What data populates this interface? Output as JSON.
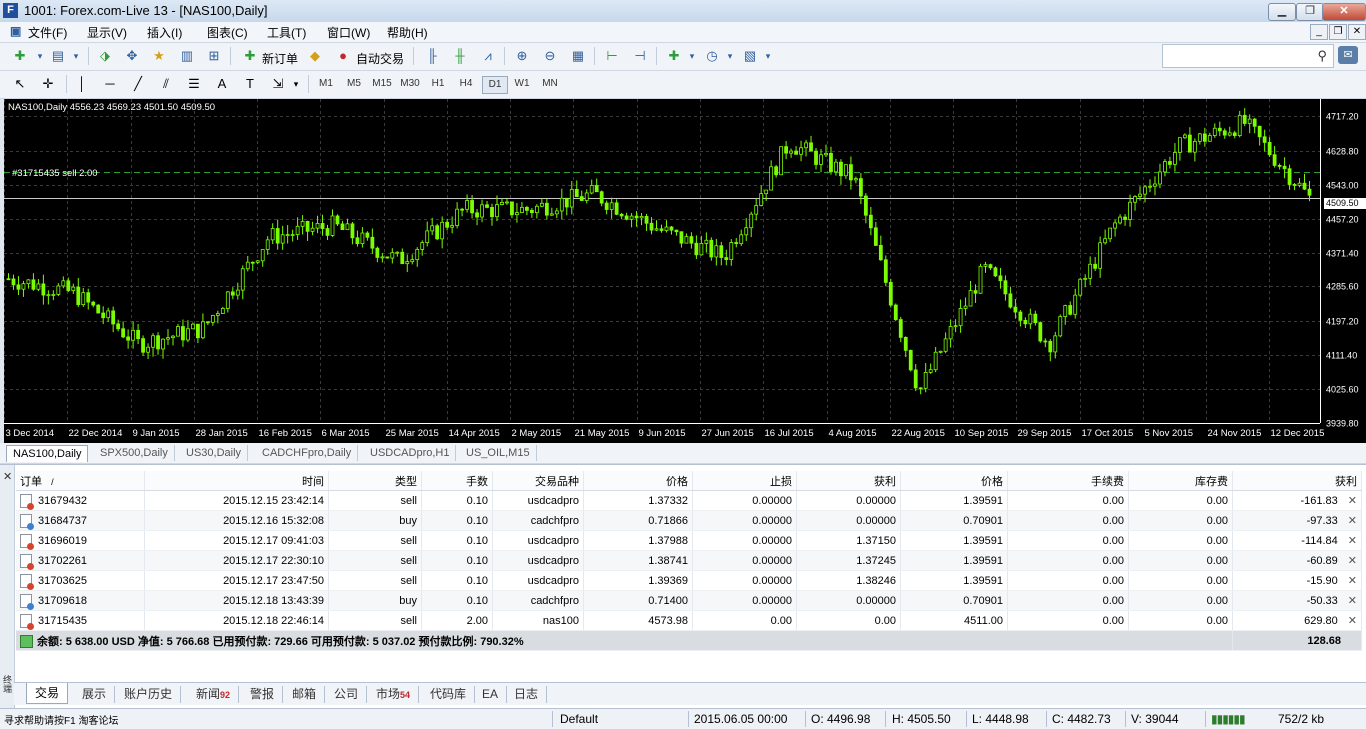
{
  "window": {
    "title": "1001: Forex.com-Live 13 - [NAS100,Daily]",
    "app_icon": "F"
  },
  "menu": [
    "文件(F)",
    "显示(V)",
    "插入(I)",
    "图表(C)",
    "工具(T)",
    "窗口(W)",
    "帮助(H)"
  ],
  "toolbar": {
    "new_order": "新订单",
    "auto_trading": "自动交易"
  },
  "timeframes": [
    "M1",
    "M5",
    "M15",
    "M30",
    "H1",
    "H4",
    "D1",
    "W1",
    "MN"
  ],
  "active_timeframe": "D1",
  "chart": {
    "header": "NAS100,Daily  4556.23 4569.23 4501.50 4509.50",
    "order_line_label": "#31715435 sell 2.00",
    "price_labels": [
      "4717.20",
      "4628.80",
      "4543.00",
      "4457.20",
      "4371.40",
      "4285.60",
      "4197.20",
      "4111.40",
      "4025.60",
      "3939.80"
    ],
    "current_price": "4509.50",
    "date_labels": [
      "3 Dec 2014",
      "22 Dec 2014",
      "9 Jan 2015",
      "28 Jan 2015",
      "16 Feb 2015",
      "6 Mar 2015",
      "25 Mar 2015",
      "14 Apr 2015",
      "2 May 2015",
      "21 May 2015",
      "9 Jun 2015",
      "27 Jun 2015",
      "16 Jul 2015",
      "4 Aug 2015",
      "22 Aug 2015",
      "10 Sep 2015",
      "29 Sep 2015",
      "17 Oct 2015",
      "5 Nov 2015",
      "24 Nov 2015",
      "12 Dec 2015"
    ],
    "colors": {
      "bull": "#7cfc00",
      "bear": "#7cfc00",
      "background": "#000000",
      "grid": "#3a3a3a"
    }
  },
  "chart_data": {
    "type": "line",
    "title": "NAS100,Daily",
    "ohlc_last": {
      "open": 4556.23,
      "high": 4569.23,
      "low": 4501.5,
      "close": 4509.5
    },
    "x": [
      "3 Dec 2014",
      "22 Dec 2014",
      "9 Jan 2015",
      "28 Jan 2015",
      "16 Feb 2015",
      "6 Mar 2015",
      "25 Mar 2015",
      "14 Apr 2015",
      "2 May 2015",
      "21 May 2015",
      "9 Jun 2015",
      "27 Jun 2015",
      "16 Jul 2015",
      "4 Aug 2015",
      "22 Aug 2015",
      "10 Sep 2015",
      "29 Sep 2015",
      "17 Oct 2015",
      "5 Nov 2015",
      "24 Nov 2015",
      "12 Dec 2015"
    ],
    "series": [
      {
        "name": "NAS100",
        "values": [
          4305,
          4270,
          4140,
          4180,
          4410,
          4440,
          4350,
          4480,
          4480,
          4520,
          4430,
          4360,
          4650,
          4560,
          4020,
          4330,
          4140,
          4440,
          4640,
          4700,
          4510
        ]
      }
    ],
    "ylim": [
      3939.8,
      4760
    ],
    "order_line": 4573.98,
    "grid": true
  },
  "chart_tabs": [
    "NAS100,Daily",
    "SPX500,Daily",
    "US30,Daily",
    "CADCHFpro,Daily",
    "USDCADpro,H1",
    "US_OIL,M15"
  ],
  "orders": {
    "columns": [
      "订单",
      "/",
      "时间",
      "类型",
      "手数",
      "交易品种",
      "价格",
      "止损",
      "获利",
      "价格",
      "手续费",
      "库存费",
      "获利"
    ],
    "rows": [
      [
        "31679432",
        "2015.12.15 23:42:14",
        "sell",
        "0.10",
        "usdcadpro",
        "1.37332",
        "0.00000",
        "0.00000",
        "1.39591",
        "0.00",
        "0.00",
        "-161.83"
      ],
      [
        "31684737",
        "2015.12.16 15:32:08",
        "buy",
        "0.10",
        "cadchfpro",
        "0.71866",
        "0.00000",
        "0.00000",
        "0.70901",
        "0.00",
        "0.00",
        "-97.33"
      ],
      [
        "31696019",
        "2015.12.17 09:41:03",
        "sell",
        "0.10",
        "usdcadpro",
        "1.37988",
        "0.00000",
        "1.37150",
        "1.39591",
        "0.00",
        "0.00",
        "-114.84"
      ],
      [
        "31702261",
        "2015.12.17 22:30:10",
        "sell",
        "0.10",
        "usdcadpro",
        "1.38741",
        "0.00000",
        "1.37245",
        "1.39591",
        "0.00",
        "0.00",
        "-60.89"
      ],
      [
        "31703625",
        "2015.12.17 23:47:50",
        "sell",
        "0.10",
        "usdcadpro",
        "1.39369",
        "0.00000",
        "1.38246",
        "1.39591",
        "0.00",
        "0.00",
        "-15.90"
      ],
      [
        "31709618",
        "2015.12.18 13:43:39",
        "buy",
        "0.10",
        "cadchfpro",
        "0.71400",
        "0.00000",
        "0.00000",
        "0.70901",
        "0.00",
        "0.00",
        "-50.33"
      ],
      [
        "31715435",
        "2015.12.18 22:46:14",
        "sell",
        "2.00",
        "nas100",
        "4573.98",
        "0.00",
        "0.00",
        "4511.00",
        "0.00",
        "0.00",
        "629.80"
      ]
    ],
    "summary": "余额: 5 638.00 USD  净值: 5 766.68  已用预付款: 729.66  可用预付款: 5 037.02  预付款比例: 790.32%",
    "summary_total": "128.68",
    "side_label": "终端"
  },
  "bottom_tabs": [
    {
      "label": "交易",
      "badge": ""
    },
    {
      "label": "展示",
      "badge": ""
    },
    {
      "label": "账户历史",
      "badge": ""
    },
    {
      "label": "新闻",
      "badge": "92"
    },
    {
      "label": "警报",
      "badge": ""
    },
    {
      "label": "邮箱",
      "badge": ""
    },
    {
      "label": "公司",
      "badge": ""
    },
    {
      "label": "市场",
      "badge": "54"
    },
    {
      "label": "代码库",
      "badge": ""
    },
    {
      "label": "EA",
      "badge": ""
    },
    {
      "label": "日志",
      "badge": ""
    }
  ],
  "status": {
    "left": "寻求帮助请按F1 淘客论坛",
    "profile": "Default",
    "date": "2015.06.05 00:00",
    "open": "O: 4496.98",
    "high": "H: 4505.50",
    "low": "L: 4448.98",
    "close": "C: 4482.73",
    "volume": "V: 39044",
    "traffic": "752/2 kb"
  }
}
